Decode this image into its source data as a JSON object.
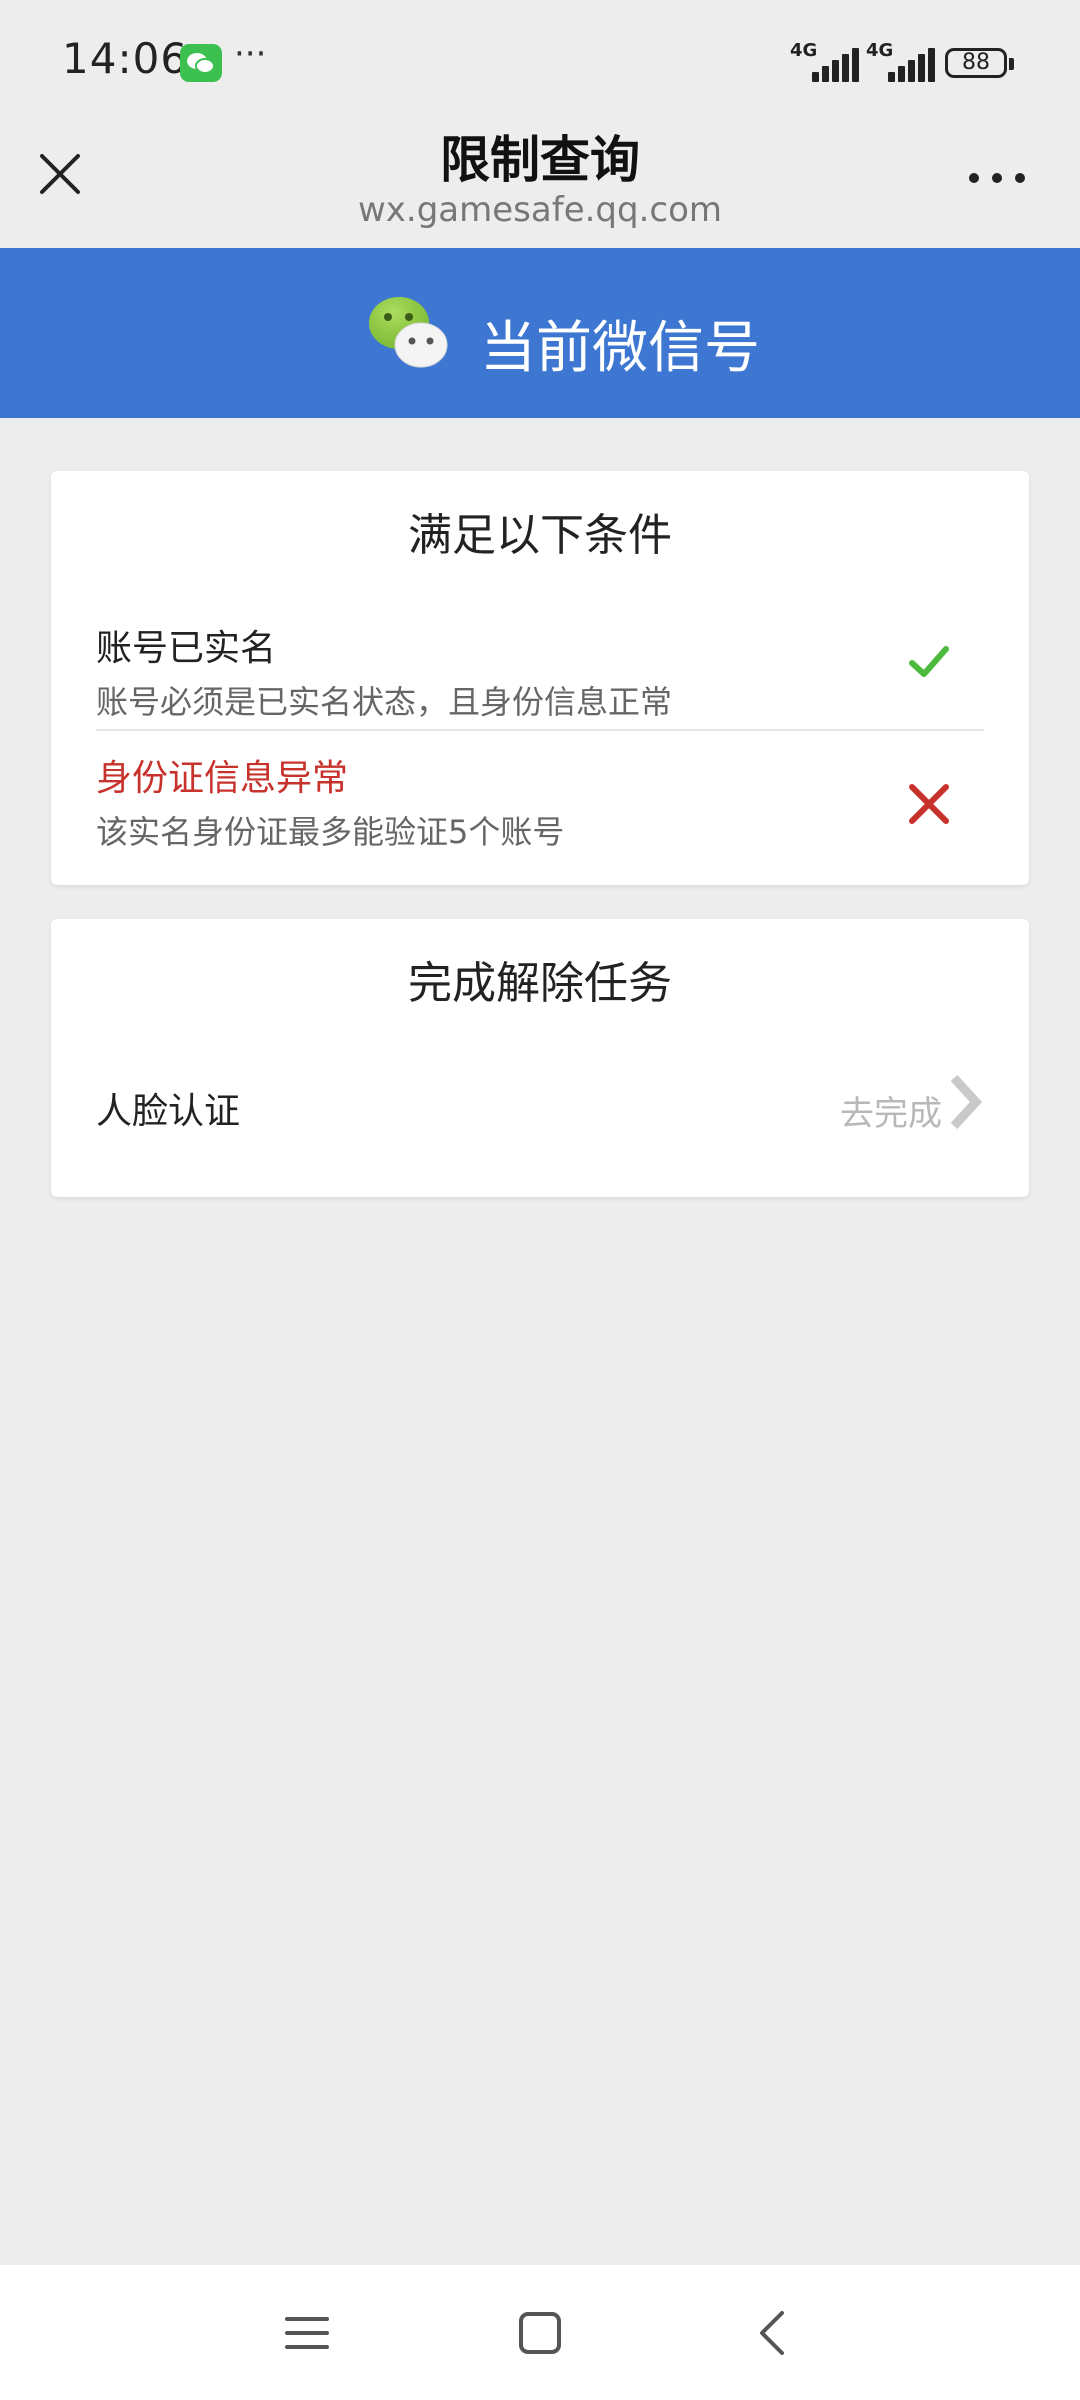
{
  "status_bar": {
    "time": "14:06",
    "more": "···",
    "signal_1": "4G",
    "signal_2": "4G",
    "battery": "88"
  },
  "nav": {
    "title": "限制查询",
    "url": "wx.gamesafe.qq.com"
  },
  "banner": {
    "text": "当前微信号"
  },
  "conditions": {
    "title": "满足以下条件",
    "items": [
      {
        "title": "账号已实名",
        "desc": "账号必须是已实名状态，且身份信息正常",
        "status": "ok"
      },
      {
        "title": "身份证信息异常",
        "desc": "该实名身份证最多能验证5个账号",
        "status": "fail"
      }
    ]
  },
  "tasks": {
    "title": "完成解除任务",
    "items": [
      {
        "label": "人脸认证",
        "action": "去完成"
      }
    ]
  },
  "colors": {
    "banner": "#3d77d2",
    "ok": "#4cba3c",
    "error": "#c8322c"
  }
}
